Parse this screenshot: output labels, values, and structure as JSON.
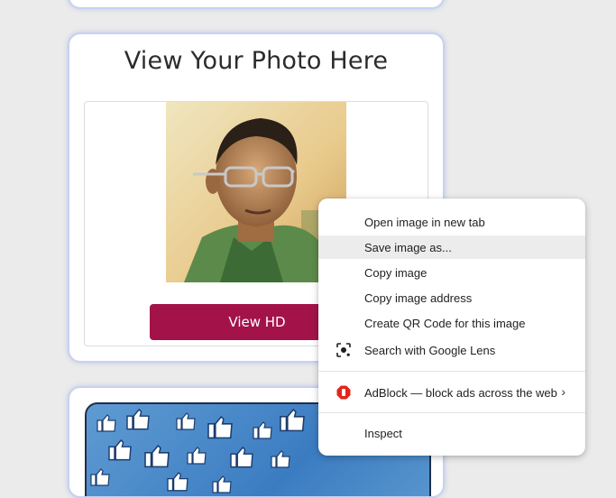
{
  "card_main": {
    "title": "View Your Photo Here",
    "button_label": "View HD"
  },
  "context_menu": {
    "items": [
      {
        "label": "Open image in new tab"
      },
      {
        "label": "Save image as..."
      },
      {
        "label": "Copy image"
      },
      {
        "label": "Copy image address"
      },
      {
        "label": "Create QR Code for this image"
      },
      {
        "label": "Search with Google Lens",
        "icon": "google-lens-icon"
      },
      {
        "label": "AdBlock — block ads across the web",
        "icon": "adblock-icon",
        "submenu": "›"
      },
      {
        "label": "Inspect"
      }
    ],
    "highlighted_index": 1
  },
  "colors": {
    "view_button": "#a3134a",
    "annotation_arrow": "#d62a2a",
    "adblock": "#e1261c"
  }
}
